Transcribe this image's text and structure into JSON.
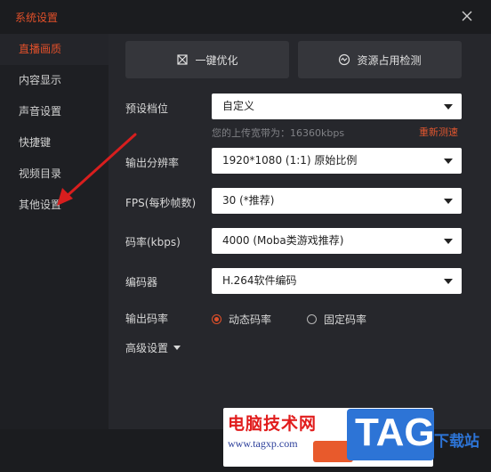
{
  "window": {
    "title": "系统设置"
  },
  "sidebar": {
    "items": [
      {
        "label": "直播画质",
        "active": true
      },
      {
        "label": "内容显示",
        "active": false
      },
      {
        "label": "声音设置",
        "active": false
      },
      {
        "label": "快捷键",
        "active": false
      },
      {
        "label": "视频目录",
        "active": false
      },
      {
        "label": "其他设置",
        "active": false
      }
    ]
  },
  "actions": {
    "optimize_label": "一键优化",
    "resource_label": "资源占用检测"
  },
  "settings": {
    "preset": {
      "label": "预设档位",
      "value": "自定义"
    },
    "upload_hint": "您的上传宽带为：16360kbps",
    "retest_label": "重新测速",
    "resolution": {
      "label": "输出分辨率",
      "value": "1920*1080 (1:1) 原始比例"
    },
    "fps": {
      "label": "FPS(每秒帧数)",
      "value": "30 (*推荐)"
    },
    "bitrate": {
      "label": "码率(kbps)",
      "value": "4000 (Moba类游戏推荐)"
    },
    "encoder": {
      "label": "编码器",
      "value": "H.264软件编码"
    },
    "rate_mode": {
      "label": "输出码率",
      "options": [
        {
          "label": "动态码率",
          "selected": true
        },
        {
          "label": "固定码率",
          "selected": false
        }
      ]
    },
    "advanced_label": "高级设置"
  },
  "watermark": {
    "site_name": "电脑技术网",
    "url": "www.tagxp.com",
    "logo": "TAG",
    "download": "下载站"
  },
  "colors": {
    "accent": "#e1502a",
    "watermark_red": "#e11c1c",
    "watermark_blue": "#2d74d6"
  }
}
